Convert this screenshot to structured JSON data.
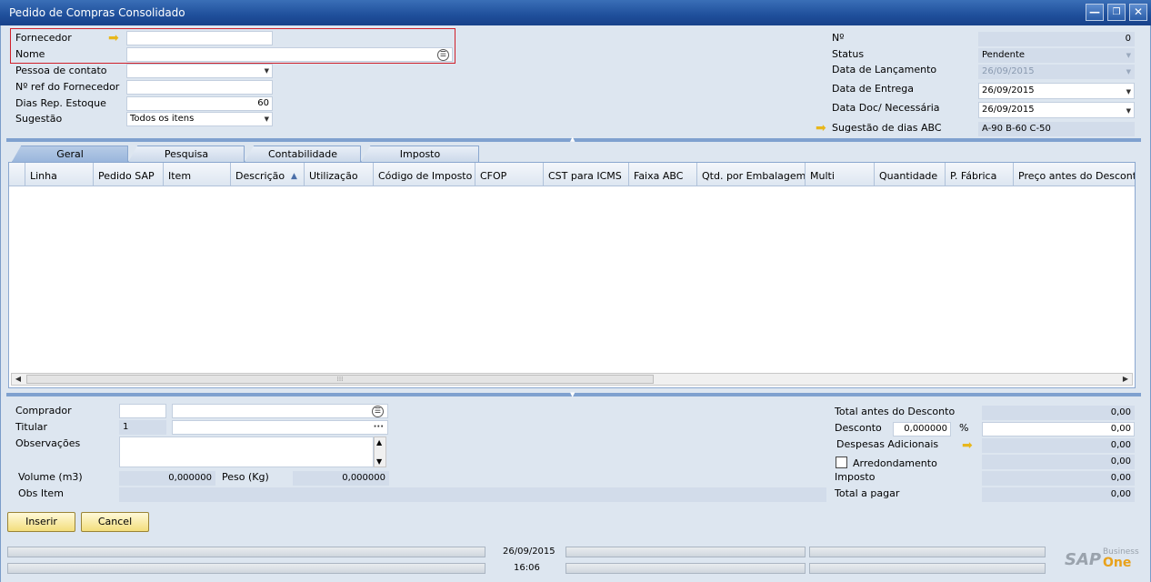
{
  "window": {
    "title": "Pedido de Compras Consolidado",
    "min_glyph": "—",
    "restore_glyph": "❐",
    "close_glyph": "✕"
  },
  "header_left": {
    "fornecedor_label": "Fornecedor",
    "fornecedor_value": "",
    "nome_label": "Nome",
    "nome_value": "",
    "pessoa_contato_label": "Pessoa de contato",
    "pessoa_contato_value": "",
    "ref_fornecedor_label": "Nº ref do Fornecedor",
    "ref_fornecedor_value": "",
    "dias_rep_label": "Dias Rep. Estoque",
    "dias_rep_value": "60",
    "sugestao_label": "Sugestão",
    "sugestao_value": "Todos os itens"
  },
  "header_right": {
    "numero_label": "Nº",
    "numero_value": "0",
    "status_label": "Status",
    "status_value": "Pendente",
    "data_lancamento_label": "Data de Lançamento",
    "data_lancamento_value": "26/09/2015",
    "data_entrega_label": "Data de Entrega",
    "data_entrega_value": "26/09/2015",
    "data_doc_label": "Data Doc/ Necessária",
    "data_doc_value": "26/09/2015",
    "sugestao_abc_label": "Sugestão de dias ABC",
    "sugestao_abc_value": "A-90 B-60 C-50"
  },
  "tabs": [
    {
      "label": "Geral",
      "active": true
    },
    {
      "label": "Pesquisa",
      "active": false
    },
    {
      "label": "Contabilidade",
      "active": false
    },
    {
      "label": "Imposto",
      "active": false
    }
  ],
  "grid": {
    "columns": [
      "Linha",
      "Pedido SAP",
      "Item",
      "Descrição",
      "Utilização",
      "Código de Imposto",
      "CFOP",
      "CST para ICMS",
      "Faixa ABC",
      "Qtd. por Embalagem",
      "Multi",
      "Quantidade",
      "P. Fábrica",
      "Preço antes do Desconto"
    ],
    "sort_glyph": "▲",
    "scroll_left": "◀",
    "scroll_right": "▶",
    "scroll_grip": "⁞⁞⁞"
  },
  "footer_left": {
    "comprador_label": "Comprador",
    "comprador_code": "",
    "comprador_name": "",
    "titular_label": "Titular",
    "titular_value": "1",
    "titular_more": "···",
    "observacoes_label": "Observações",
    "observacoes_value": "",
    "volume_label": "Volume (m3)",
    "volume_value": "0,000000",
    "peso_label": "Peso (Kg)",
    "peso_value": "0,000000",
    "obs_item_label": "Obs Item",
    "obs_item_value": ""
  },
  "footer_right": {
    "total_antes_label": "Total antes do Desconto",
    "total_antes_value": "0,00",
    "desconto_label": "Desconto",
    "desconto_pct": "0,000000",
    "pct_symbol": "%",
    "desconto_value": "0,00",
    "despesas_label": "Despesas Adicionais",
    "despesas_value": "0,00",
    "arredondamento_label": "Arredondamento",
    "arredondamento_value": "0,00",
    "imposto_label": "Imposto",
    "imposto_value": "0,00",
    "total_pagar_label": "Total a pagar",
    "total_pagar_value": "0,00"
  },
  "buttons": {
    "inserir": "Inserir",
    "cancelar": "Cancel"
  },
  "statusbar": {
    "date": "26/09/2015",
    "time": "16:06",
    "brand_sap": "SAP",
    "brand_business": "Business",
    "brand_one": "One"
  },
  "colors": {
    "accent": "#1f4f9b",
    "highlight_border": "#d0202a",
    "button": "#f3de7c",
    "arrow": "#e8b71c"
  }
}
